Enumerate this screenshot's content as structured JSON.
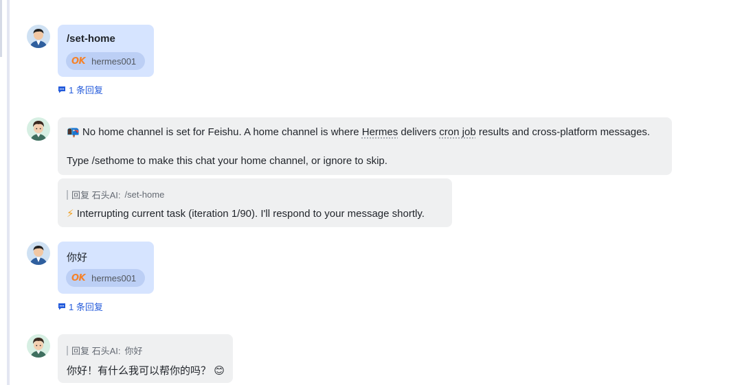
{
  "messages": {
    "m1": {
      "command": "/set-home",
      "reaction_user": "hermes001",
      "reaction_icon": "OK",
      "reply_count": "1 条回复"
    },
    "m2": {
      "line1_icon": "📭",
      "line1_pre": "No home channel is set for Feishu. A home channel is where ",
      "line1_hermes": "Hermes",
      "line1_mid": " delivers ",
      "line1_cron": "cron job",
      "line1_post": " results and cross-platform messages.",
      "line2": "Type /sethome to make this chat your home channel, or ignore to skip."
    },
    "m3": {
      "quote_prefix": "回复 石头AI:",
      "quote_text": "/set-home",
      "icon": "⚡",
      "text": "Interrupting current task (iteration 1/90). I'll respond to your message shortly."
    },
    "m4": {
      "text": "你好",
      "reaction_user": "hermes001",
      "reaction_icon": "OK",
      "reply_count": "1 条回复"
    },
    "m5": {
      "quote_prefix": "回复 石头AI:",
      "quote_text": "你好",
      "text": "你好！有什么我可以帮你的吗？",
      "emoji": "😊"
    }
  },
  "colors": {
    "user_bubble": "#d6e4ff",
    "bot_bubble": "#eff0f1",
    "link": "#245bdb",
    "ok_orange": "#f5822a"
  }
}
